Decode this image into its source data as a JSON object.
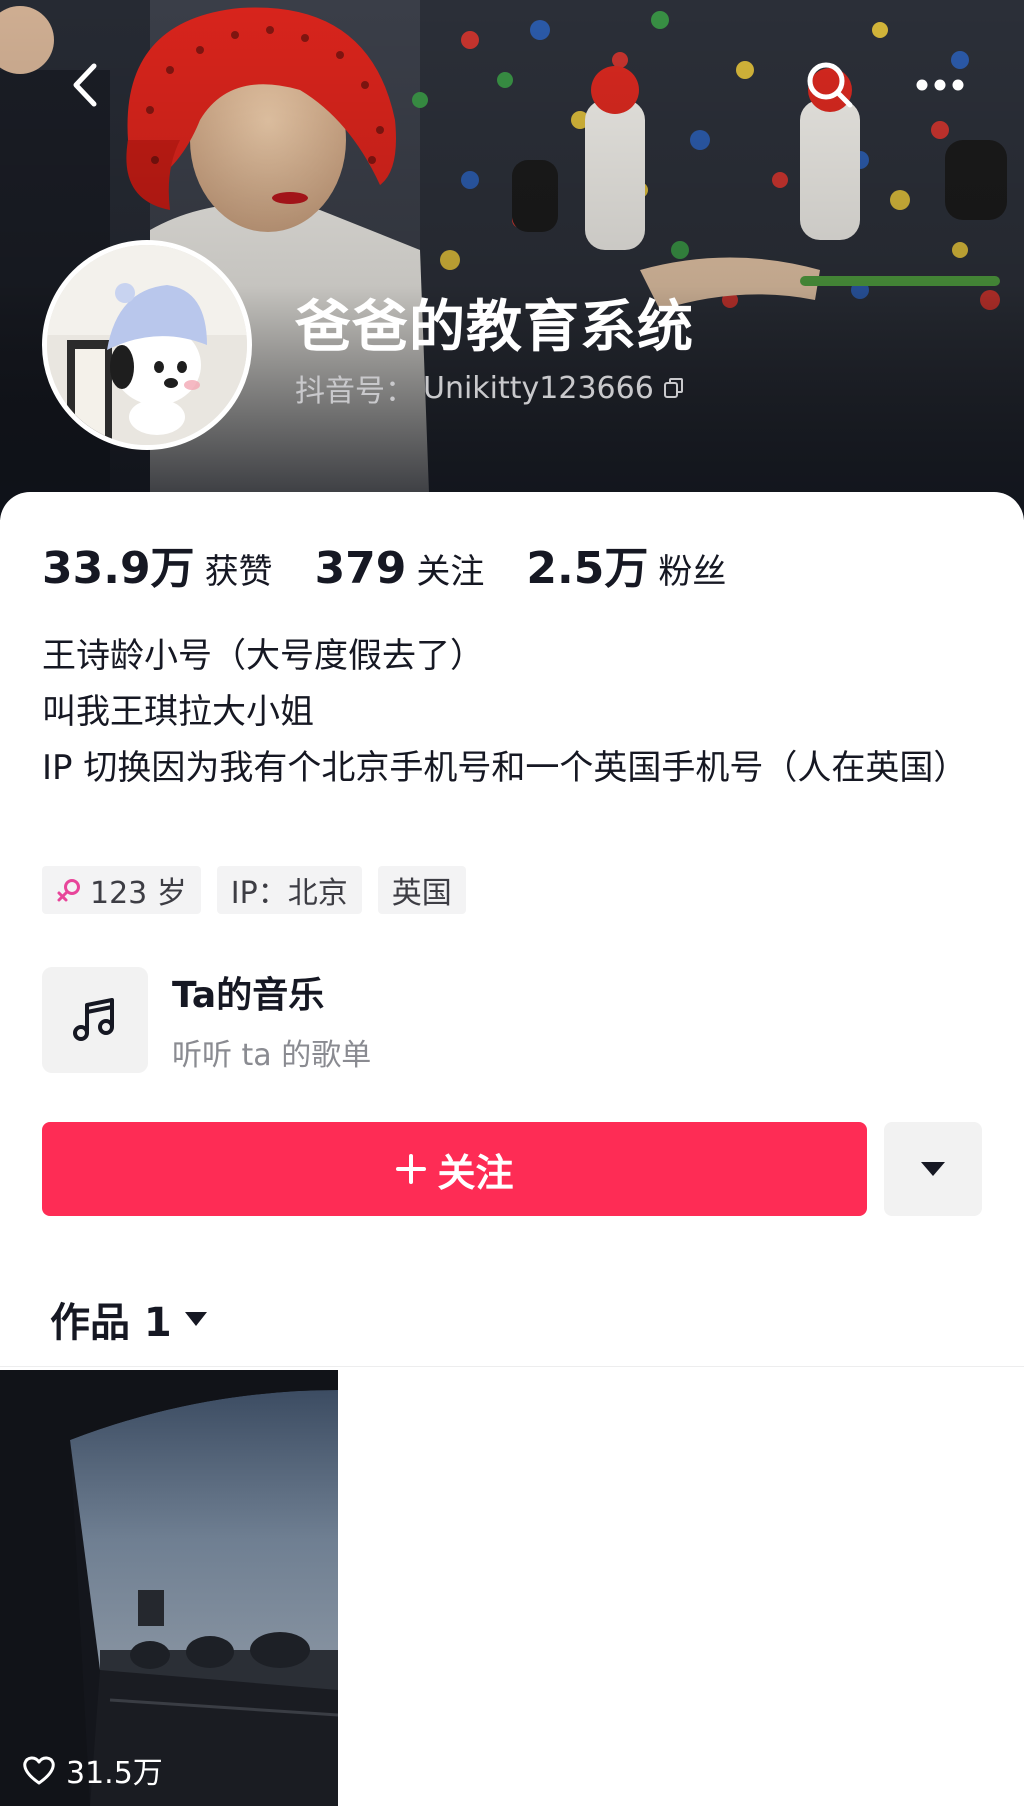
{
  "header": {
    "display_name": "爸爸的教育系统",
    "douyin_id_label": "抖音号：",
    "douyin_id": "Unikitty123666"
  },
  "stats": [
    {
      "value": "33.9万",
      "label": "获赞"
    },
    {
      "value": "379",
      "label": "关注"
    },
    {
      "value": "2.5万",
      "label": "粉丝"
    }
  ],
  "bio": [
    "王诗龄小号（大号度假去了）",
    "叫我王琪拉大小姐",
    "IP 切换因为我有个北京手机号和一个英国手机号（人在英国）"
  ],
  "tags": {
    "age": "123 岁",
    "ip": "IP：北京",
    "location": "英国"
  },
  "music": {
    "title": "Ta的音乐",
    "subtitle": "听听 ta 的歌单"
  },
  "actions": {
    "follow_label": "关注"
  },
  "works_tab": {
    "label": "作品 1"
  },
  "videos": [
    {
      "likes": "31.5万"
    }
  ],
  "colors": {
    "accent": "#fe2c55",
    "female_icon": "#e8459a"
  },
  "icons": [
    "back-arrow-icon",
    "search-icon",
    "more-dots-icon",
    "copy-icon",
    "female-icon",
    "music-note-icon",
    "plus-icon",
    "caret-down-icon",
    "heart-icon"
  ]
}
